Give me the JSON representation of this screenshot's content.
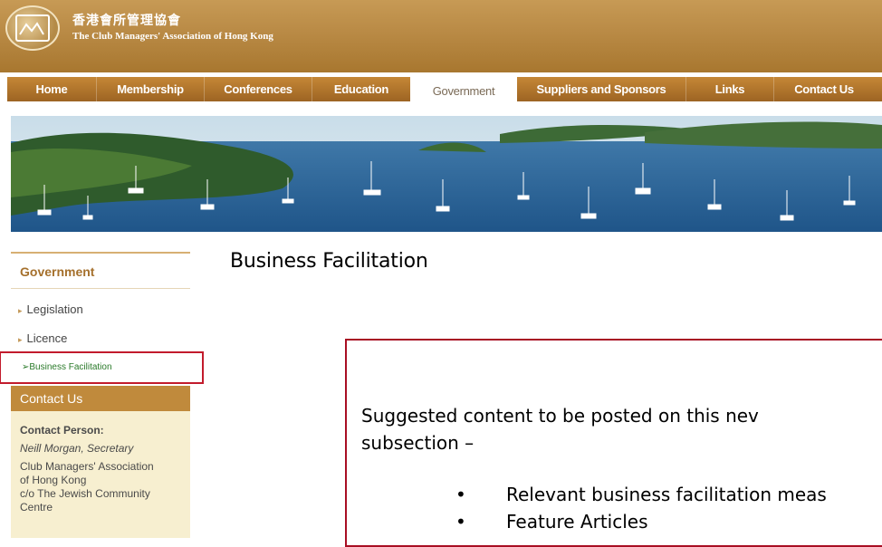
{
  "header": {
    "logo_cn": "香港會所管理協會",
    "logo_en": "The Club Managers' Association of Hong Kong"
  },
  "nav": {
    "items": [
      {
        "label": "Home"
      },
      {
        "label": "Membership"
      },
      {
        "label": "Conferences"
      },
      {
        "label": "Education"
      },
      {
        "label": "Government",
        "active": true
      },
      {
        "label": "Suppliers and Sponsors"
      },
      {
        "label": "Links"
      },
      {
        "label": "Contact Us"
      }
    ]
  },
  "sidebar": {
    "title": "Government",
    "links": [
      "Legislation",
      "Licence"
    ],
    "current": "➢Business Facilitation",
    "contact": {
      "title": "Contact Us",
      "person_label": "Contact Person:",
      "person": "Neill Morgan, Secretary",
      "org_line1": "Club Managers' Association",
      "org_line2": "of Hong Kong",
      "org_line3": "c/o The Jewish Community",
      "org_line4": "Centre"
    }
  },
  "main": {
    "title": "Business Facilitation",
    "callout": {
      "line1": "Suggested content to be posted on this nev",
      "line2": "subsection –",
      "bullets": [
        "Relevant business facilitation meas",
        "Feature Articles"
      ]
    }
  },
  "colors": {
    "header": "#b98a45",
    "nav": "#b07530",
    "accent": "#c08a3c",
    "highlight_box": "#c21b2c",
    "current_link": "#2a7a2a"
  }
}
